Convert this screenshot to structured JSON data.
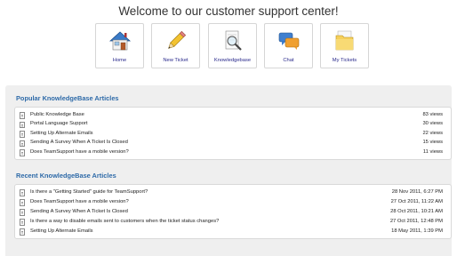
{
  "header": {
    "title": "Welcome to our customer support center!"
  },
  "tiles": [
    {
      "label": "Home",
      "icon": "home-icon"
    },
    {
      "label": "New Ticket",
      "icon": "pencil-icon"
    },
    {
      "label": "Knowledgebase",
      "icon": "magnifier-document-icon"
    },
    {
      "label": "Chat",
      "icon": "chat-bubbles-icon"
    },
    {
      "label": "My Tickets",
      "icon": "folder-icon"
    }
  ],
  "popular": {
    "heading": "Popular KnowledgeBase Articles",
    "items": [
      {
        "title": "Public Knowledge Base",
        "views": "83 views"
      },
      {
        "title": "Portal Language Support",
        "views": "30 views"
      },
      {
        "title": "Setting Up Alternate Emails",
        "views": "22 views"
      },
      {
        "title": "Sending A Survey When A Ticket Is Closed",
        "views": "15 views"
      },
      {
        "title": "Does TeamSupport have a mobile version?",
        "views": "11 views"
      }
    ]
  },
  "recent": {
    "heading": "Recent KnowledgeBase Articles",
    "items": [
      {
        "title": "Is there a \"Getting Started\" guide for TeamSupport?",
        "date": "28 Nov 2011, 6:27 PM"
      },
      {
        "title": "Does TeamSupport have a mobile version?",
        "date": "27 Oct 2011, 11:22 AM"
      },
      {
        "title": "Sending A Survey When A Ticket Is Closed",
        "date": "28 Oct 2011, 10:21 AM"
      },
      {
        "title": "Is there a way to disable emails sent to customers when the ticket status changes?",
        "date": "27 Oct 2011, 12:48 PM"
      },
      {
        "title": "Setting Up Alternate Emails",
        "date": "18 May 2011, 1:39 PM"
      }
    ]
  },
  "colors": {
    "heading": "#2e6aa8",
    "tile_label": "#2a2a8c",
    "panel_bg": "#efefef"
  }
}
